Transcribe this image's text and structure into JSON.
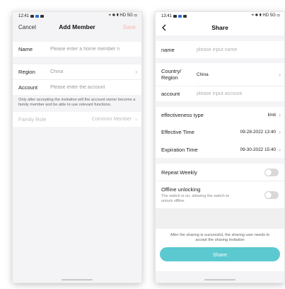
{
  "left": {
    "status": {
      "time": "12:41",
      "right": "⌖ ✱ ⧫ HD 5G ▭"
    },
    "nav": {
      "cancel": "Cancel",
      "title": "Add Member",
      "save": "Save"
    },
    "name": {
      "label": "Name",
      "placeholder": "Please enter a home member n"
    },
    "region": {
      "label": "Region",
      "value": "China"
    },
    "account": {
      "label": "Account",
      "placeholder": "Please enter the account"
    },
    "note": "Only after accepting the invitation will the account owner become a family member and be able to use relevant functions.",
    "family_role": {
      "label": "Family Role",
      "value": "Common Member"
    }
  },
  "right": {
    "status": {
      "time": "13:41",
      "right": "⌖ ✱ ⧫ HD 5G ▭"
    },
    "nav": {
      "title": "Share"
    },
    "name": {
      "label": "name",
      "placeholder": "please input name"
    },
    "country": {
      "label_1": "Country/",
      "label_2": "Region",
      "value": "China"
    },
    "account": {
      "label": "account",
      "placeholder": "please input account"
    },
    "effectiveness": {
      "label": "effectiveness type",
      "value": "limit"
    },
    "effective_time": {
      "label": "Effective Time",
      "value": "09-28-2022 13:40"
    },
    "expiration_time": {
      "label": "Expiration Time",
      "value": "09-30-2022 15:40"
    },
    "repeat_weekly": {
      "label": "Repeat Weekly"
    },
    "offline": {
      "label": "Offline unlocking",
      "desc_1": "The switch is on, allowing the switch to",
      "desc_2": "unlock offline"
    },
    "footer_note": "After the sharing is successful, the sharing user needs to accept the sharing invitation",
    "share_button": "Share",
    "colors": {
      "accent": "#5cc9d0",
      "save_disabled": "#f6b7a8"
    }
  }
}
